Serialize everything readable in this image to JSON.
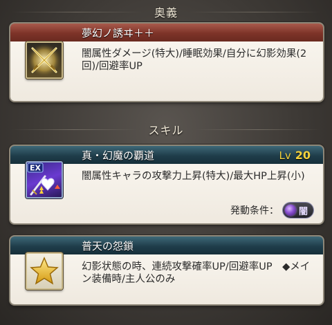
{
  "headers": {
    "ougi": "奥義",
    "skill": "スキル"
  },
  "ougi": {
    "name": "夢幻ノ誘ヰ＋＋",
    "description": "闇属性ダメージ(特大)/睡眠効果/自分に幻影効果(2回)/回避率UP",
    "icon": "crossed-swords-icon"
  },
  "skills": [
    {
      "name": "真・幻魔の覇道",
      "level_label": "Lv",
      "level": "20",
      "description": "闇属性キャラの攻撃力上昇(特大)/最大HP上昇(小)",
      "condition_label": "発動条件：",
      "condition_element": "闇",
      "badge": "EX",
      "icon": "ex-skill-sword-heart-icon"
    },
    {
      "name": "普天の怨鎖",
      "description": "幻影状態の時、連続攻撃確率UP/回避率UP　◆メイン装備時/主人公のみ",
      "icon": "gold-star-icon"
    }
  ]
}
